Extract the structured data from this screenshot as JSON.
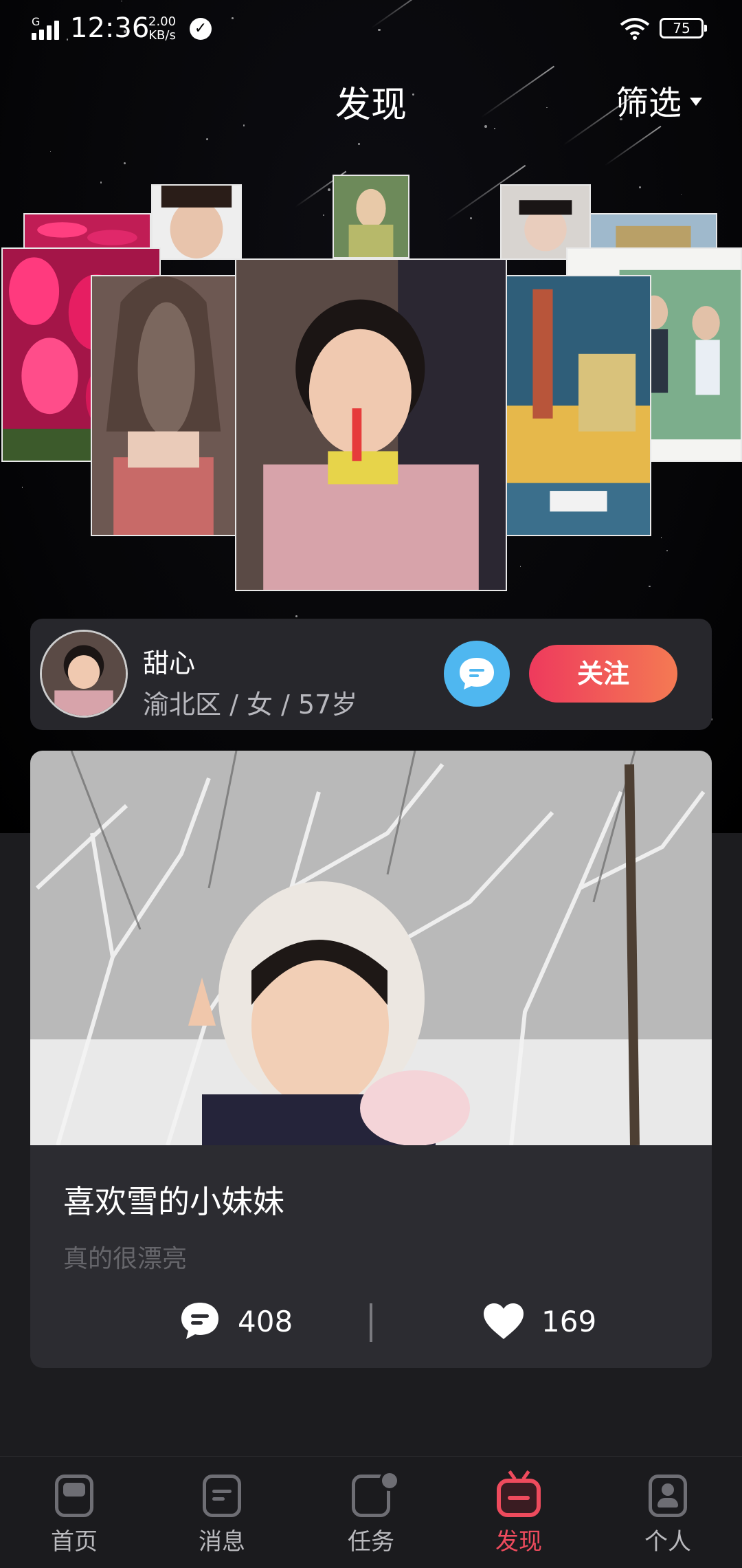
{
  "status_bar": {
    "network": "G",
    "time": "12:36",
    "speed_value": "2.00",
    "speed_unit": "KB/s",
    "battery": "75"
  },
  "header": {
    "title": "发现",
    "filter_label": "筛选"
  },
  "profile": {
    "name": "甜心",
    "info": "渝北区 / 女 / 57岁",
    "follow_label": "关注"
  },
  "post": {
    "title": "喜欢雪的小妹妹",
    "subtitle": "真的很漂亮",
    "comments": "408",
    "likes": "169"
  },
  "nav": {
    "items": [
      {
        "label": "首页",
        "icon": "home-icon"
      },
      {
        "label": "消息",
        "icon": "message-icon"
      },
      {
        "label": "任务",
        "icon": "task-icon"
      },
      {
        "label": "发现",
        "icon": "discover-tv-icon",
        "active": true
      },
      {
        "label": "个人",
        "icon": "profile-icon"
      }
    ]
  },
  "colors": {
    "accent": "#ee4b5d",
    "chat_blue": "#4fb7f0",
    "card": "#27272c"
  }
}
